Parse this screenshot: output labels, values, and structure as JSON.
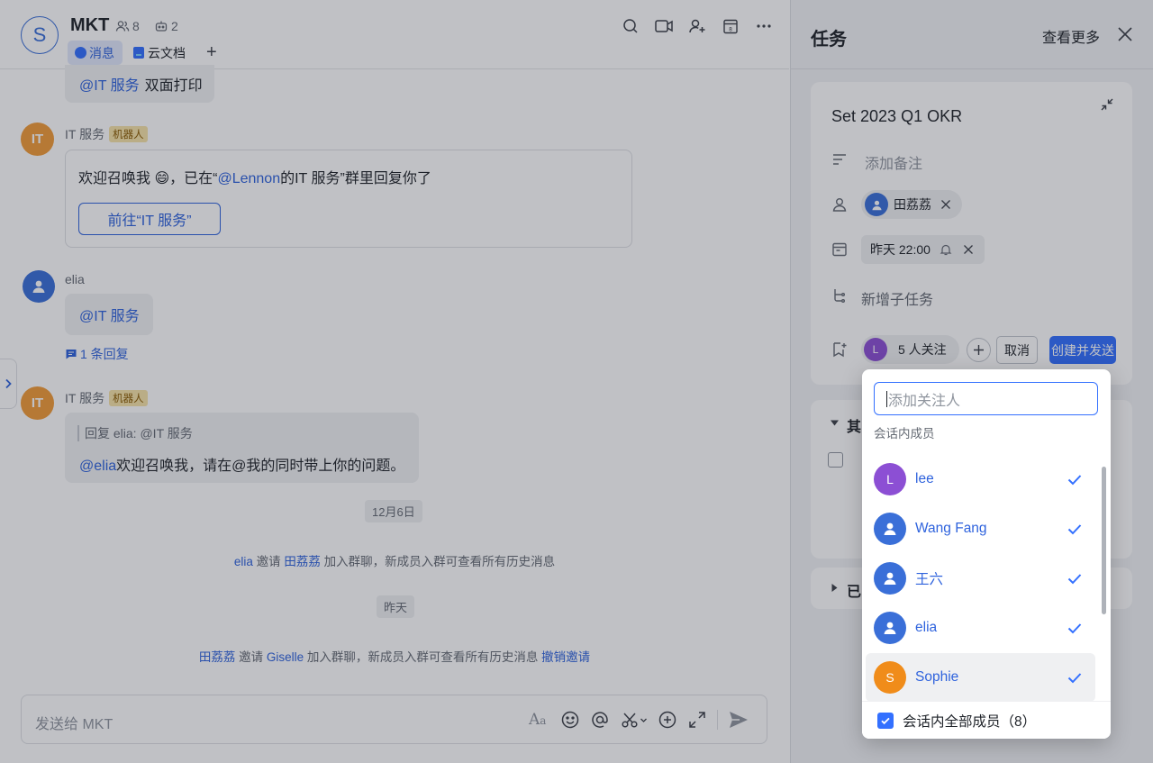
{
  "chat": {
    "avatar_letter": "S",
    "title": "MKT",
    "member_count": "8",
    "bot_count": "2",
    "tabs": [
      {
        "label": "消息",
        "icon": "message-icon",
        "active": true
      },
      {
        "label": "云文档",
        "icon": "doc-icon",
        "active": false
      }
    ],
    "add_tab": "+",
    "header_icons": [
      "search-icon",
      "video-icon",
      "add-member-icon",
      "calendar-icon",
      "more-icon"
    ],
    "messages": {
      "m0": {
        "mention": "@IT 服务",
        "text": "双面打印"
      },
      "m1": {
        "avatar": "IT",
        "sender": "IT 服务",
        "badge": "机器人",
        "text_before": "欢迎召唤我 😄，已在“",
        "mention": "@Lennon",
        "text_after": "的IT 服务”群里回复你了",
        "button": "前往“IT 服务”"
      },
      "m2": {
        "sender": "elia",
        "mention": "@IT 服务",
        "reply_count": "1 条回复"
      },
      "m3": {
        "avatar": "IT",
        "sender": "IT 服务",
        "badge": "机器人",
        "quote": "回复 elia: @IT 服务",
        "mention": "@elia",
        "text": "欢迎召唤我，请在@我的同时带上你的问题。"
      }
    },
    "date1": "12月6日",
    "sys1": {
      "user1": "elia",
      "verb": "邀请",
      "user2": "田荔荔",
      "rest": "加入群聊，新成员入群可查看所有历史消息"
    },
    "date2": "昨天",
    "sys2": {
      "user1": "田荔荔",
      "verb": "邀请",
      "user2": "Giselle",
      "rest": "加入群聊，新成员入群可查看所有历史消息",
      "action": "撤销邀请"
    },
    "input_placeholder": "发送给 MKT",
    "input_icons": [
      "font-icon",
      "emoji-icon",
      "mention-icon",
      "scissors-icon",
      "add-icon",
      "expand-icon",
      "send-icon"
    ],
    "collapse_arrow": "›"
  },
  "task": {
    "panel_title": "任务",
    "view_more": "查看更多",
    "card": {
      "title": "Set 2023 Q1 OKR",
      "note_placeholder": "添加备注",
      "assignee": "田荔荔",
      "due": "昨天 22:00",
      "subtask": "新增子任务",
      "follower_avatar": "L",
      "followers": "5 人关注",
      "cancel": "取消",
      "create_send": "创建并发送"
    },
    "section1_label": "其",
    "section2_label": "已"
  },
  "dropdown": {
    "search_placeholder": "添加关注人",
    "section_label": "会话内成员",
    "members": [
      {
        "name": "lee",
        "avatar": "L",
        "color": "#8c4fd4",
        "checked": true
      },
      {
        "name": "Wang Fang",
        "avatar": "",
        "color": "#3a6fd8",
        "checked": true
      },
      {
        "name": "王六",
        "avatar": "",
        "color": "#3a6fd8",
        "checked": true
      },
      {
        "name": "elia",
        "avatar": "",
        "color": "#3a6fd8",
        "checked": true
      },
      {
        "name": "Sophie",
        "avatar": "S",
        "color": "#f08c1a",
        "checked": true
      }
    ],
    "select_all": "会话内全部成员（8）",
    "select_all_checked": true
  },
  "colors": {
    "accent": "#3370ff",
    "mention": "#2f63dd",
    "bot_badge": "#f7e3a8",
    "it_avatar": "#f29c38"
  }
}
